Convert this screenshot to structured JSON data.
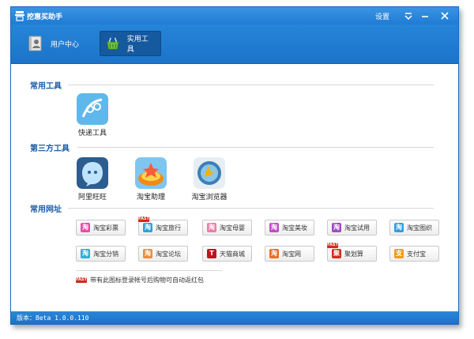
{
  "window": {
    "title": "挖惠买助手"
  },
  "titlebar": {
    "settings_label": "设置"
  },
  "tabs": [
    {
      "label": "用户中心",
      "icon": "user-center-icon"
    },
    {
      "label": "实用工具",
      "icon": "tool-basket-icon",
      "active": true
    }
  ],
  "sections": {
    "common_tools": {
      "title": "常用工具",
      "items": [
        {
          "label": "快递工具",
          "icon": "express-icon"
        }
      ]
    },
    "third_party": {
      "title": "第三方工具",
      "items": [
        {
          "label": "阿里旺旺",
          "icon": "aliwangwang-icon"
        },
        {
          "label": "淘宝助理",
          "icon": "taobao-assistant-icon"
        },
        {
          "label": "淘宝浏览器",
          "icon": "taobao-browser-icon"
        }
      ]
    },
    "common_sites": {
      "title": "常用网址",
      "links": [
        {
          "label": "淘宝彩票",
          "fast": false
        },
        {
          "label": "淘宝旅行",
          "fast": true
        },
        {
          "label": "淘宝母婴",
          "fast": false
        },
        {
          "label": "淘宝美妆",
          "fast": false
        },
        {
          "label": "淘宝试用",
          "fast": false
        },
        {
          "label": "淘宝图织",
          "fast": false
        },
        {
          "label": "淘宝分销",
          "fast": false
        },
        {
          "label": "淘宝论坛",
          "fast": false
        },
        {
          "label": "天猫商城",
          "fast": false
        },
        {
          "label": "淘宝网",
          "fast": false
        },
        {
          "label": "聚划算",
          "fast": true
        },
        {
          "label": "支付宝",
          "fast": false
        }
      ]
    }
  },
  "badge": {
    "text": "FAST"
  },
  "note": {
    "text": "带有此图标登录帐号后购物可自动返红包"
  },
  "status": {
    "version": "版本：Beta 1.0.0.110"
  },
  "colors": {
    "accent": "#1f7bd4",
    "section_title": "#1b5ea8",
    "badge": "#d32a1d"
  }
}
